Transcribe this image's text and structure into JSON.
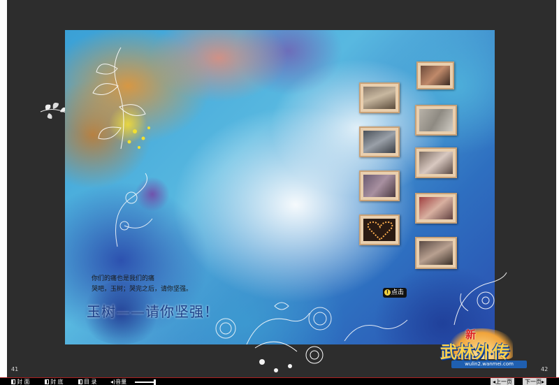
{
  "page": {
    "poem_lines": [
      "你们的痛也是我们的痛",
      "哭吧，玉树；哭完之后，请你坚强。"
    ],
    "title": "玉树——请你坚强！",
    "click_hint": "点击",
    "photos": [
      {
        "id": "photo-1",
        "scene": "mother and child"
      },
      {
        "id": "photo-2",
        "scene": "elderly man"
      },
      {
        "id": "photo-3",
        "scene": "collapsed buildings"
      },
      {
        "id": "photo-4",
        "scene": "rescue workers"
      },
      {
        "id": "photo-5",
        "scene": "injured person"
      },
      {
        "id": "photo-6",
        "scene": "people gathered"
      },
      {
        "id": "photo-7",
        "scene": "children"
      },
      {
        "id": "photo-8",
        "scene": "candle heart"
      },
      {
        "id": "photo-9",
        "scene": "family"
      }
    ]
  },
  "page_numbers": {
    "left": "41",
    "right": "42"
  },
  "logo": {
    "xin": "新",
    "name": "武林外传",
    "url": "wulin2.wanmei.com"
  },
  "toolbar": {
    "cover_label": "封 面",
    "back_cover_label": "封 底",
    "toc_label": "目 录",
    "volume_label": "音量",
    "volume_level": 0.9,
    "prev_label": "上一页",
    "next_label": "下一页"
  },
  "colors": {
    "toolbar_bg": "#000000",
    "toolbar_accent": "#ab2020",
    "title_blue": "#1c3f88"
  }
}
